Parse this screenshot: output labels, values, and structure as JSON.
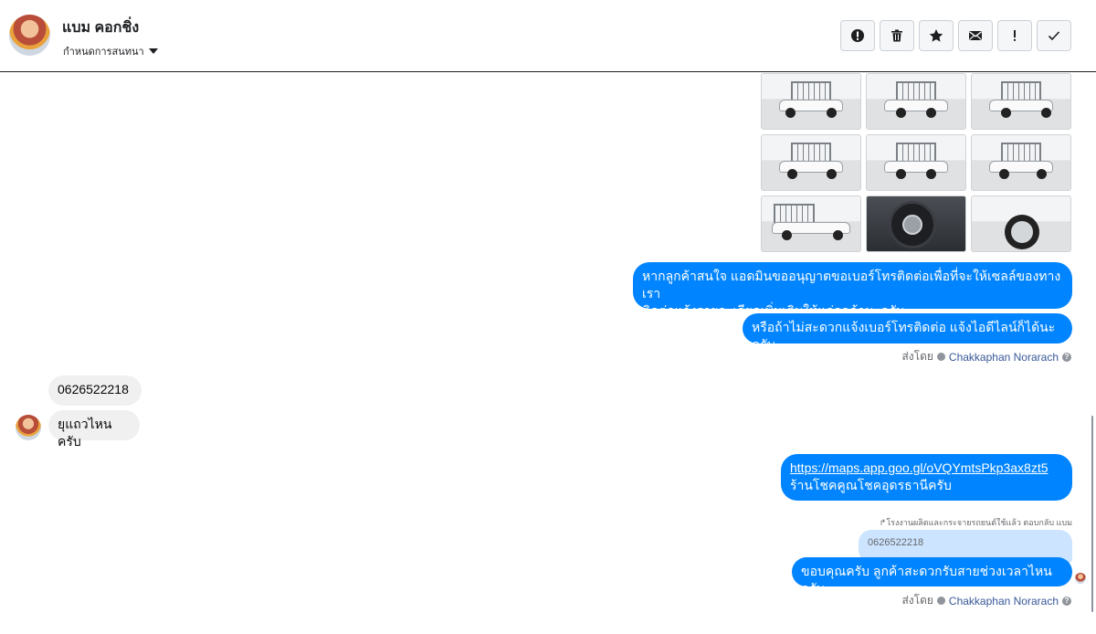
{
  "header": {
    "contact_name": "แบม คอกชิ่ง",
    "label_dropdown": "กำหนดการสนทนา",
    "actions": [
      "spam-icon",
      "trash-icon",
      "star-icon",
      "envelope-icon",
      "exclamation-icon",
      "check-icon"
    ]
  },
  "messages": {
    "out1": "หากลูกค้าสนใจ แอดมินขออนุญาตขอเบอร์โทรติดต่อเพื่อที่จะให้เซลล์ของทางเราติดต่อแจ้งรายละเอียดเพิ่มเติมให้แก่ลูกค้านะครับ",
    "out1_line1": "หากลูกค้าสนใจ แอดมินขออนุญาตขอเบอร์โทรติดต่อเพื่อที่จะให้เซลล์ของทางเรา",
    "out1_line2": "ติดต่อแจ้งรายละเอียดเพิ่มเติมให้แก่ลูกค้านะครับ",
    "out2": "หรือถ้าไม่สะดวกแจ้งเบอร์โทรติดต่อ แจ้งไอดีไลน์ก็ได้นะครับ",
    "sent_by_prefix_1": "ส่งโดย",
    "sent_by_name_1": "Chakkaphan Norarach",
    "in1": "0626522218",
    "in2": "ยุแถวไหนครับ",
    "out3_link": "https://maps.app.goo.gl/oVQYmtsPkp3ax8zt5",
    "out3_text": "ร้านโชคคูณโชคอุดรธานีครับ",
    "reply_note": "↱โรงงานผลิตและกระจายรถยนต์ใช้แล้ว ตอบกลับ แบม",
    "reply_quote": "0626522218",
    "out4": "ขอบคุณครับ ลูกค้าสะดวกรับสายช่วงเวลาไหนครับ",
    "sent_by_prefix_2": "ส่งโดย",
    "sent_by_name_2": "Chakkaphan Norarach"
  },
  "colors": {
    "outgoing_bubble": "#0084ff",
    "incoming_bubble": "#f1f0f0",
    "reply_quote_bg": "#cce4ff"
  }
}
